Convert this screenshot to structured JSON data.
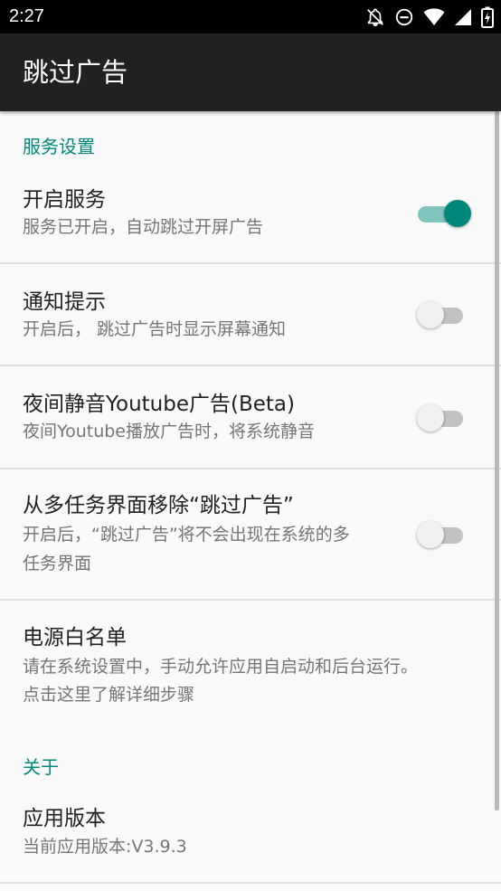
{
  "status_bar": {
    "time": "2:27",
    "icons": [
      "notifications-off-icon",
      "do-not-disturb-icon",
      "wifi-icon",
      "cellular-signal-icon",
      "battery-icon"
    ]
  },
  "app_bar": {
    "title": "跳过广告"
  },
  "sections": {
    "service": {
      "header": "服务设置",
      "enable_service": {
        "title": "开启服务",
        "summary": "服务已开启，自动跳过开屏广告",
        "enabled": true
      },
      "notification": {
        "title": "通知提示",
        "summary": "开启后， 跳过广告时显示屏幕通知",
        "enabled": false
      },
      "night_mute": {
        "title": "夜间静音Youtube广告(Beta)",
        "summary": "夜间Youtube播放广告时，将系统静音",
        "enabled": false
      },
      "hide_recents": {
        "title": "从多任务界面移除“跳过广告”",
        "summary_line1": "开启后，“跳过广告”将不会出现在系统的多",
        "summary_line2": "任务界面",
        "enabled": false
      },
      "power_whitelist": {
        "title": "电源白名单",
        "summary_line1": "请在系统设置中，手动允许应用自启动和后台运行。",
        "summary_line2": "点击这里了解详细步骤"
      }
    },
    "about": {
      "header": "关于",
      "app_version": {
        "title": "应用版本",
        "summary": "当前应用版本:V3.9.3"
      }
    }
  },
  "colors": {
    "accent": "#00897b",
    "app_bar": "#212121",
    "status_bar": "#000000",
    "background": "#fafafa"
  }
}
